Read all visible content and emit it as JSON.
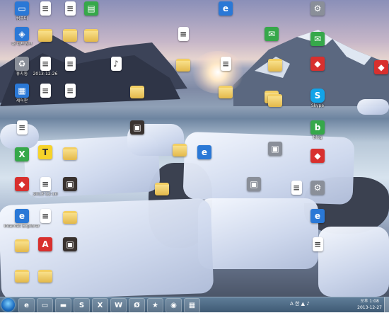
{
  "desktop": {
    "icons": [
      {
        "label": "컴퓨터",
        "icon": "computer-icon"
      },
      {
        "label": "내 네트워크",
        "icon": "network-icon"
      },
      {
        "label": "휴지통",
        "icon": "recycle-bin-icon"
      },
      {
        "label": "제어판",
        "icon": "control-panel-icon"
      },
      {
        "label": "",
        "icon": "document-icon"
      },
      {
        "label": "",
        "icon": "excel-icon"
      },
      {
        "label": "",
        "icon": "app-icon"
      },
      {
        "label": "Internet Explorer",
        "icon": "internet-explorer-icon"
      },
      {
        "label": "",
        "icon": "folder-icon"
      },
      {
        "label": "",
        "icon": "folder-icon"
      },
      {
        "label": "",
        "icon": "document-icon"
      },
      {
        "label": "",
        "icon": "folder-icon"
      },
      {
        "label": "2013-12-26",
        "icon": "document-icon"
      },
      {
        "label": "",
        "icon": "document-icon"
      },
      {
        "label": "",
        "icon": "kakaotalk-icon"
      },
      {
        "label": "2013-12-10",
        "icon": "document-icon"
      },
      {
        "label": "",
        "icon": "document-icon"
      },
      {
        "label": "",
        "icon": "pdf-icon"
      },
      {
        "label": "",
        "icon": "folder-icon"
      },
      {
        "label": "",
        "icon": "document-icon"
      },
      {
        "label": "",
        "icon": "folder-icon"
      },
      {
        "label": "",
        "icon": "document-icon"
      },
      {
        "label": "",
        "icon": "document-icon"
      },
      {
        "label": "",
        "icon": "folder-icon"
      },
      {
        "label": "",
        "icon": "photo-icon"
      },
      {
        "label": "",
        "icon": "folder-icon"
      },
      {
        "label": "",
        "icon": "photo-icon"
      },
      {
        "label": "",
        "icon": "spreadsheet-icon"
      },
      {
        "label": "",
        "icon": "folder-icon"
      },
      {
        "label": "",
        "icon": "music-icon"
      },
      {
        "label": "",
        "icon": "folder-icon"
      },
      {
        "label": "",
        "icon": "photo-icon"
      },
      {
        "label": "",
        "icon": "folder-icon"
      },
      {
        "label": "",
        "icon": "document-icon"
      },
      {
        "label": "",
        "icon": "folder-icon"
      },
      {
        "label": "",
        "icon": "folder-icon"
      },
      {
        "label": "",
        "icon": "internet-explorer-icon"
      },
      {
        "label": "",
        "icon": "internet-explorer-icon"
      },
      {
        "label": "",
        "icon": "document-icon"
      },
      {
        "label": "",
        "icon": "folder-icon"
      },
      {
        "label": "",
        "icon": "application-icon"
      },
      {
        "label": "",
        "icon": "application-icon"
      },
      {
        "label": "",
        "icon": "chat-icon"
      },
      {
        "label": "",
        "icon": "folder-icon"
      },
      {
        "label": "",
        "icon": "folder-icon"
      },
      {
        "label": "",
        "icon": "folder-icon"
      },
      {
        "label": "",
        "icon": "document-icon"
      },
      {
        "label": "",
        "icon": "tools-icon"
      },
      {
        "label": "",
        "icon": "chat-icon"
      },
      {
        "label": "",
        "icon": "app-icon"
      },
      {
        "label": "Skype",
        "icon": "skype-icon"
      },
      {
        "label": "blog",
        "icon": "blog-icon"
      },
      {
        "label": "",
        "icon": "app-icon"
      },
      {
        "label": "",
        "icon": "tools-icon"
      },
      {
        "label": "",
        "icon": "internet-explorer-icon"
      },
      {
        "label": "",
        "icon": "document-icon"
      },
      {
        "label": "",
        "icon": "app-icon"
      }
    ]
  },
  "taskbar": {
    "pinned": [
      {
        "glyph": "e",
        "icon": "internet-explorer-icon"
      },
      {
        "glyph": "▭",
        "icon": "explorer-icon"
      },
      {
        "glyph": "▬",
        "icon": "folder-icon"
      },
      {
        "glyph": "S",
        "icon": "skype-icon"
      },
      {
        "glyph": "X",
        "icon": "excel-icon"
      },
      {
        "glyph": "W",
        "icon": "word-icon"
      },
      {
        "glyph": "Ø",
        "icon": "media-icon"
      },
      {
        "glyph": "★",
        "icon": "app-icon"
      },
      {
        "glyph": "◉",
        "icon": "paint-icon"
      },
      {
        "glyph": "▦",
        "icon": "app-icon"
      }
    ],
    "tray": "A 한 ▲ ♪",
    "clock_time": "오후 1:08",
    "clock_date": "2013-12-27"
  }
}
